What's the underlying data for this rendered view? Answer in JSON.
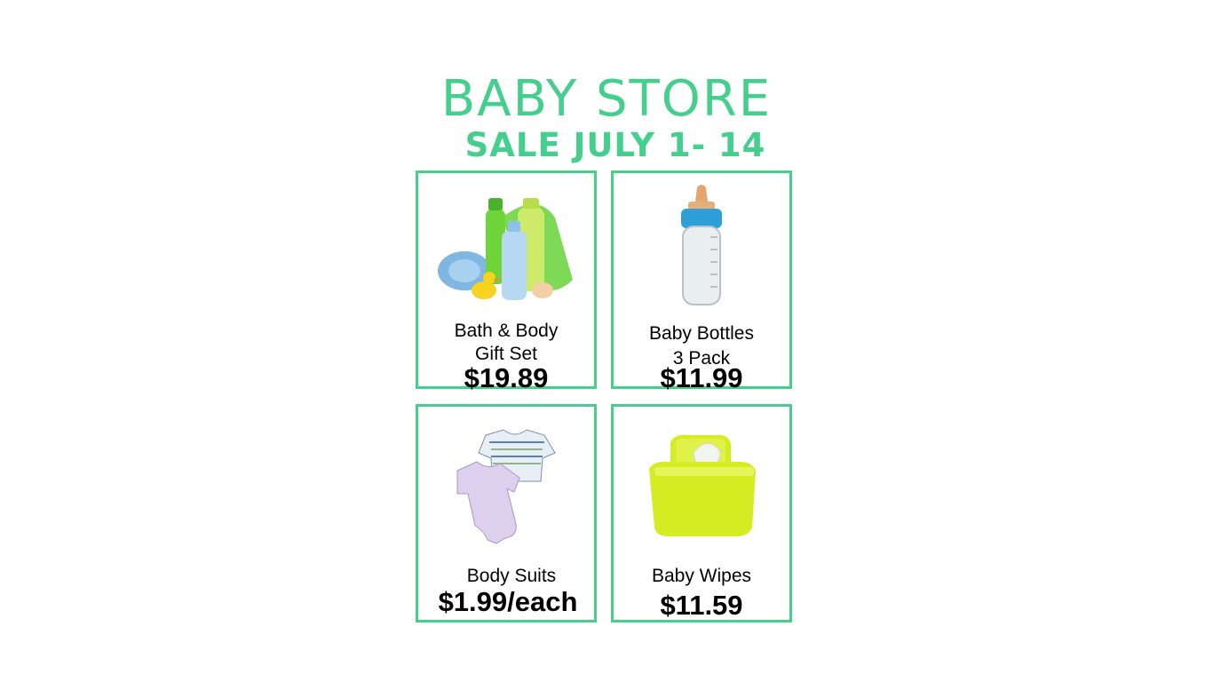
{
  "header": {
    "title": "BABY STORE",
    "subtitle": "SALE JULY 1- 14"
  },
  "products": [
    {
      "name_line1": "Bath & Body",
      "name_line2": "Gift Set",
      "price": "$19.89",
      "image_icon": "bath-products-icon"
    },
    {
      "name_line1": "Baby Bottles",
      "name_line2": "3 Pack",
      "price": "$11.99",
      "image_icon": "baby-bottle-icon"
    },
    {
      "name_line1": "Body Suits",
      "name_line2": "",
      "price": "$1.99/each",
      "image_icon": "bodysuit-icon"
    },
    {
      "name_line1": "Baby Wipes",
      "name_line2": "",
      "price": "$11.59",
      "image_icon": "wipes-container-icon"
    }
  ],
  "colors": {
    "accent": "#44cf8c",
    "text": "#000000"
  }
}
